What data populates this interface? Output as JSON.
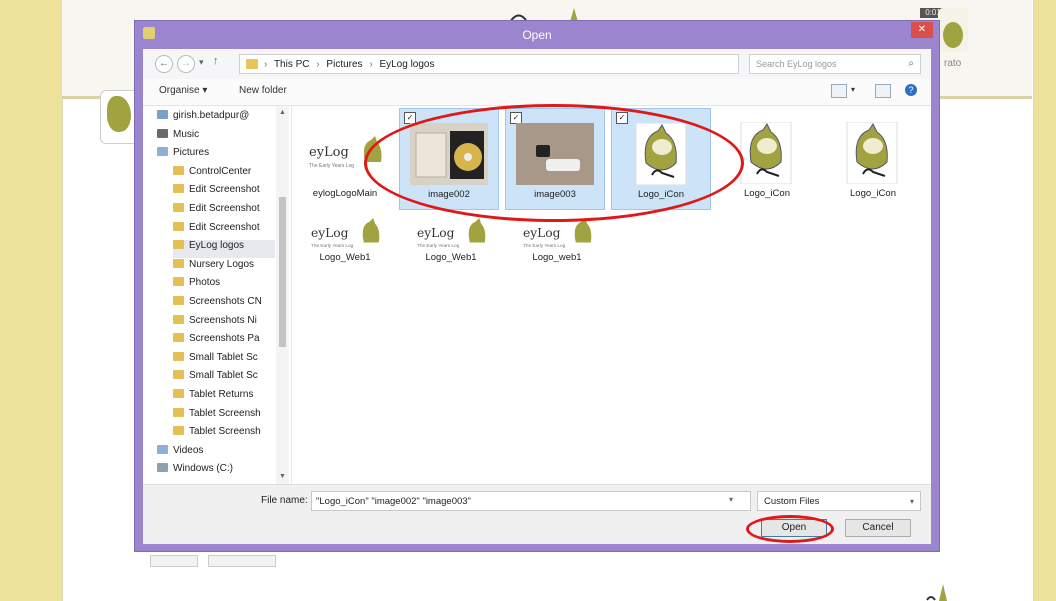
{
  "background": {
    "right_text": "rato",
    "badge_text": "0:01"
  },
  "dialog": {
    "title": "Open",
    "close_glyph": "✕",
    "address": {
      "crumbs": [
        "This PC",
        "Pictures",
        "EyLog logos"
      ],
      "search_placeholder": "Search EyLog logos"
    },
    "toolbar": {
      "organize": "Organise ▾",
      "new_folder": "New folder"
    },
    "tree": [
      {
        "label": "girish.betadpur@",
        "kind": "user"
      },
      {
        "label": "Music",
        "kind": "music"
      },
      {
        "label": "Pictures",
        "kind": "pictures"
      },
      {
        "label": "ControlCenter",
        "kind": "folder",
        "sub": true
      },
      {
        "label": "Edit Screenshot",
        "kind": "folder",
        "sub": true
      },
      {
        "label": "Edit Screenshot",
        "kind": "folder",
        "sub": true
      },
      {
        "label": "Edit Screenshot",
        "kind": "folder",
        "sub": true
      },
      {
        "label": "EyLog logos",
        "kind": "folder",
        "sub": true,
        "selected": true
      },
      {
        "label": "Nursery Logos",
        "kind": "folder",
        "sub": true
      },
      {
        "label": "Photos",
        "kind": "folder",
        "sub": true
      },
      {
        "label": "Screenshots CN",
        "kind": "folder",
        "sub": true
      },
      {
        "label": "Screenshots Ni",
        "kind": "folder",
        "sub": true
      },
      {
        "label": "Screenshots Pa",
        "kind": "folder",
        "sub": true
      },
      {
        "label": "Small Tablet Sc",
        "kind": "folder",
        "sub": true
      },
      {
        "label": "Small Tablet Sc",
        "kind": "folder",
        "sub": true
      },
      {
        "label": "Tablet Returns",
        "kind": "folder",
        "sub": true
      },
      {
        "label": "Tablet Screensh",
        "kind": "folder",
        "sub": true
      },
      {
        "label": "Tablet Screensh",
        "kind": "folder",
        "sub": true
      },
      {
        "label": "Videos",
        "kind": "pictures"
      },
      {
        "label": "Windows (C:)",
        "kind": "drive"
      }
    ],
    "files": [
      {
        "name": "eylogLogoMain",
        "thumb": "wide-logo",
        "selected": false
      },
      {
        "name": "image002",
        "thumb": "photo-disc",
        "selected": true
      },
      {
        "name": "image003",
        "thumb": "photo-usb",
        "selected": true
      },
      {
        "name": "Logo_iCon",
        "thumb": "icon-logo",
        "selected": true
      },
      {
        "name": "Logo_iCon",
        "thumb": "icon-logo",
        "selected": false
      },
      {
        "name": "Logo_iCon",
        "thumb": "icon-logo",
        "selected": false
      },
      {
        "name": "Logo_Web1",
        "thumb": "wide-logo",
        "selected": false
      },
      {
        "name": "Logo_Web1",
        "thumb": "wide-logo",
        "selected": false
      },
      {
        "name": "Logo_web1",
        "thumb": "wide-logo",
        "selected": false
      }
    ],
    "logo_text": "eyLog",
    "logo_tagline": "The Early Years Log",
    "checkbox_glyph": "✓",
    "file_name_label": "File name:",
    "file_name_value": "\"Logo_iCon\" \"image002\" \"image003\"",
    "file_type": "Custom Files",
    "open_label": "Open",
    "cancel_label": "Cancel"
  },
  "colors": {
    "dialog_frame": "#9a85ce",
    "selection": "#cce3f8",
    "annotation": "#e01818",
    "logo_green": "#a0a340"
  }
}
